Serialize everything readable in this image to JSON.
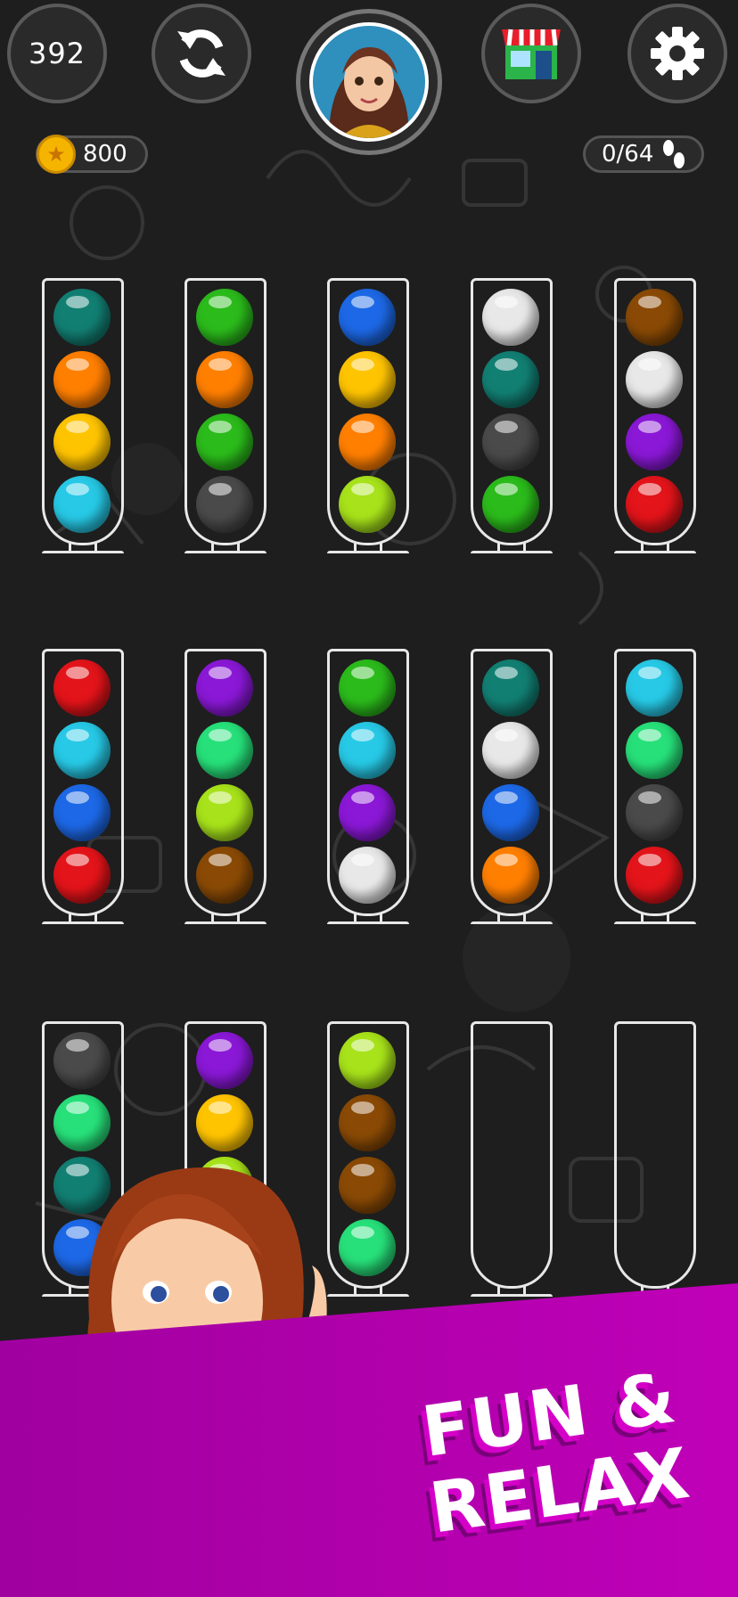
{
  "header": {
    "level_number": "392",
    "coins": "800",
    "moves": "0/64"
  },
  "buttons": {
    "level_icon": "level-badge",
    "restart_icon": "refresh-icon",
    "avatar_icon": "avatar-portrait",
    "shop_icon": "shop-icon",
    "settings_icon": "gear-icon",
    "coin_icon": "star-coin-icon",
    "moves_icon": "footprints-icon"
  },
  "colors": {
    "teal": "#127f73",
    "orange": "#ff7f00",
    "yellow": "#ffc400",
    "cyan": "#27c9e6",
    "green": "#2bbb1b",
    "gray": "#4a4a4a",
    "blue": "#1d68e6",
    "lime": "#a7e21a",
    "white": "#e8e8e8",
    "brown": "#8a4a05",
    "purple": "#8a18d6",
    "red": "#e3141a",
    "mint": "#27e07a"
  },
  "tubes": [
    {
      "balls": [
        "teal",
        "orange",
        "yellow",
        "cyan"
      ]
    },
    {
      "balls": [
        "green",
        "orange",
        "green",
        "gray"
      ]
    },
    {
      "balls": [
        "blue",
        "yellow",
        "orange",
        "lime"
      ]
    },
    {
      "balls": [
        "white",
        "teal",
        "gray",
        "green"
      ]
    },
    {
      "balls": [
        "brown",
        "white",
        "purple",
        "red"
      ]
    },
    {
      "balls": [
        "red",
        "cyan",
        "blue",
        "red"
      ]
    },
    {
      "balls": [
        "purple",
        "mint",
        "lime",
        "brown"
      ]
    },
    {
      "balls": [
        "green",
        "cyan",
        "purple",
        "white"
      ]
    },
    {
      "balls": [
        "teal",
        "white",
        "blue",
        "orange"
      ]
    },
    {
      "balls": [
        "cyan",
        "mint",
        "gray",
        "red"
      ]
    },
    {
      "balls": [
        "gray",
        "mint",
        "teal",
        "blue"
      ]
    },
    {
      "balls": [
        "purple",
        "yellow",
        "lime"
      ]
    },
    {
      "balls": [
        "lime",
        "brown",
        "brown",
        "mint"
      ]
    },
    {
      "balls": []
    },
    {
      "balls": []
    }
  ],
  "promo": {
    "line1": "FUN &",
    "line2": "RELAX"
  }
}
